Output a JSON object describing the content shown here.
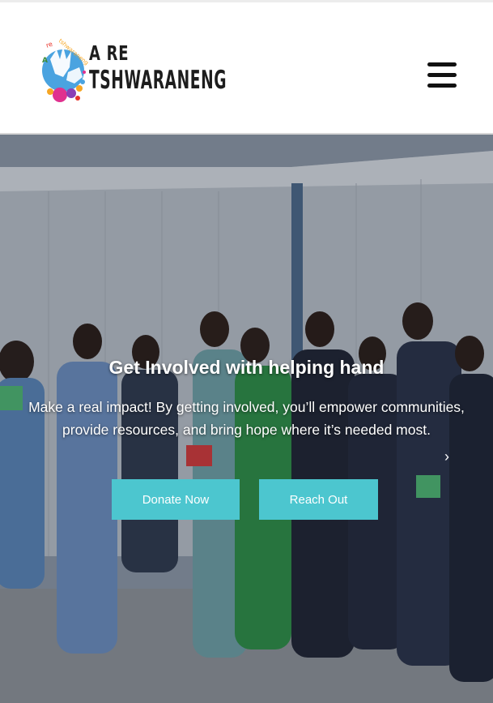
{
  "header": {
    "logo": {
      "line1": "A RE",
      "line2": "TSHWARANENG",
      "arc_text": "A re tshwaraneng"
    },
    "menu_icon": "hamburger-menu-icon"
  },
  "hero": {
    "title": "Get Involved with helping hand",
    "description": "Make a real impact! By getting involved, you’ll empower communities, provide resources, and bring hope where it’s needed most.",
    "buttons": {
      "donate": "Donate Now",
      "reach": "Reach Out"
    },
    "next_icon": "chevron-right-icon",
    "next_glyph": "›"
  },
  "colors": {
    "accent": "#4cc6cf",
    "header_bg": "#ffffff",
    "text_light": "#ffffff"
  }
}
